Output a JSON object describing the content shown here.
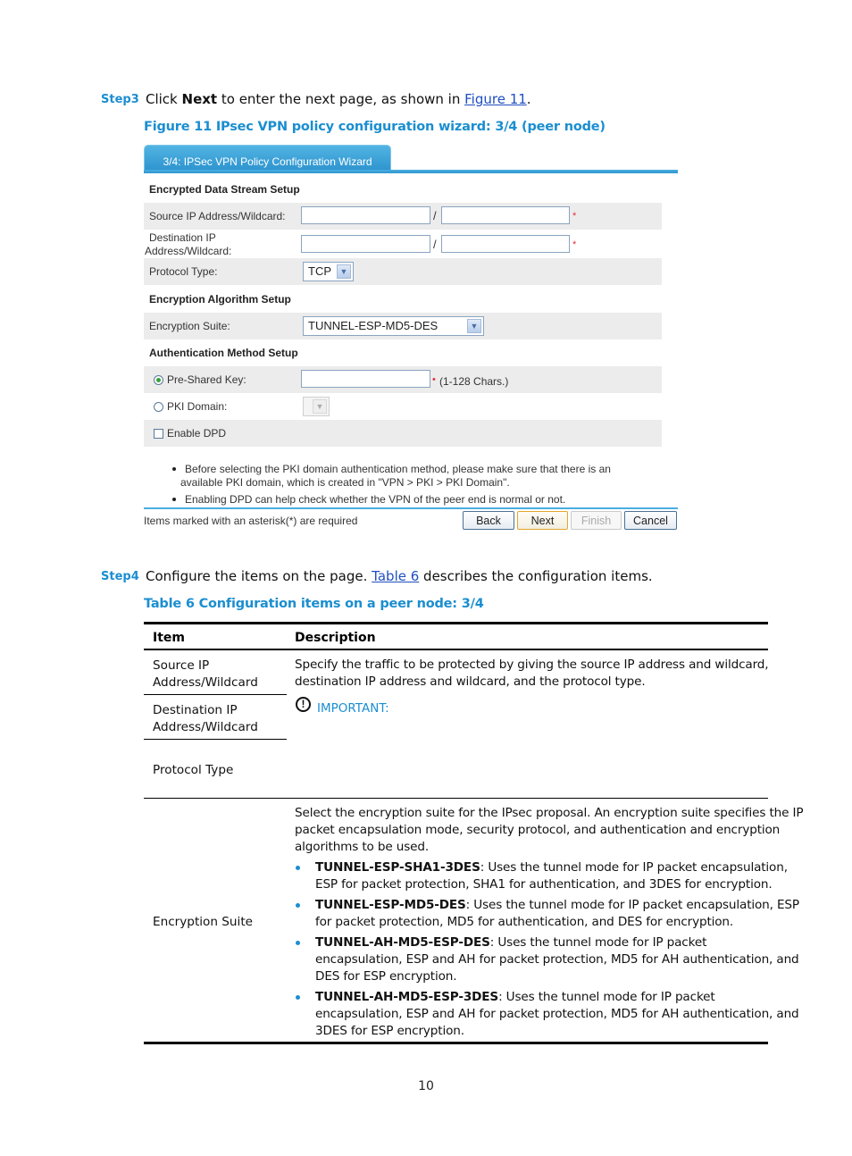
{
  "step3": {
    "label": "Step3",
    "text_before": "Click ",
    "bold": "Next",
    "text_middle": " to enter the next page, as shown in ",
    "link": "Figure 11",
    "text_after": "."
  },
  "figure_caption": "Figure 11 IPsec VPN policy configuration wizard: 3/4 (peer node)",
  "wizard": {
    "tab_title": "3/4: IPSec VPN Policy Configuration Wizard",
    "sections": {
      "data_stream": "Encrypted Data Stream Setup",
      "encryption": "Encryption Algorithm Setup",
      "auth": "Authentication Method Setup"
    },
    "fields": {
      "source_label": "Source IP Address/Wildcard:",
      "source_ip": "",
      "source_wildcard": "",
      "dest_label_line1": "Destination IP",
      "dest_label_line2": "Address/Wildcard:",
      "dest_ip": "",
      "dest_wildcard": "",
      "slash": "/",
      "required_mark": "*",
      "protocol_label": "Protocol Type:",
      "protocol_value": "TCP",
      "suite_label": "Encryption Suite:",
      "suite_value": "TUNNEL-ESP-MD5-DES",
      "psk_label": "Pre-Shared Key:",
      "psk_value": "",
      "psk_hint": "(1-128 Chars.)",
      "psk_selected": true,
      "pki_label": "PKI Domain:",
      "pki_value": "",
      "pki_selected": false,
      "dpd_label": "Enable DPD",
      "dpd_checked": false
    },
    "notes": [
      {
        "line1": "Before selecting the PKI domain authentication method, please make sure that there is an",
        "line2": "available PKI domain, which is created in \"VPN > PKI > PKI Domain\"."
      },
      {
        "line1": "Enabling DPD can help check whether the VPN of the peer end is normal or not.",
        "line2": ""
      }
    ],
    "required_note": "Items marked with an asterisk(*) are required",
    "buttons": {
      "back": "Back",
      "next": "Next",
      "finish": "Finish",
      "cancel": "Cancel"
    },
    "colors": {
      "tab": "#2f95cf",
      "required": "#e0303c",
      "row_gray": "#ececec"
    }
  },
  "step4": {
    "label": "Step4",
    "text_before": "Configure the items on the page. ",
    "link": "Table 6",
    "text_after": " describes the configuration items."
  },
  "table_caption": "Table 6 Configuration items on a peer node: 3/4",
  "table": {
    "headers": {
      "item": "Item",
      "description": "Description"
    },
    "rows": {
      "source": {
        "line1": "Source IP",
        "line2": "Address/Wildcard"
      },
      "dest": {
        "line1": "Destination IP",
        "line2": "Address/Wildcard"
      },
      "protocol": "Protocol Type",
      "suite": "Encryption Suite"
    },
    "desc_traffic": {
      "line1": "Specify the traffic to be protected by giving the source IP address and wildcard,",
      "line2": "destination IP address and wildcard, and the protocol type."
    },
    "important_label": "IMPORTANT:",
    "desc_suite": {
      "line1": "Select the encryption suite for the IPsec proposal. An encryption suite specifies the IP",
      "line2": "packet encapsulation mode, security protocol, and authentication and encryption",
      "line3": "algorithms to be used."
    },
    "suites": [
      {
        "name": "TUNNEL-ESP-SHA1-3DES",
        "l1": ": Uses the tunnel mode for IP packet encapsulation,",
        "l2": "ESP for packet protection, SHA1 for authentication, and 3DES for encryption.",
        "l3": ""
      },
      {
        "name": "TUNNEL-ESP-MD5-DES",
        "l1": ": Uses the tunnel mode for IP packet encapsulation, ESP",
        "l2": "for packet protection, MD5 for authentication, and DES for encryption.",
        "l3": ""
      },
      {
        "name": "TUNNEL-AH-MD5-ESP-DES",
        "l1": ": Uses the tunnel mode for IP packet",
        "l2": "encapsulation, ESP and AH for packet protection, MD5 for AH authentication, and",
        "l3": "DES for ESP encryption."
      },
      {
        "name": "TUNNEL-AH-MD5-ESP-3DES",
        "l1": ": Uses the tunnel mode for IP packet",
        "l2": "encapsulation, ESP and AH for packet protection, MD5 for AH authentication, and",
        "l3": "3DES for ESP encryption."
      }
    ]
  },
  "page_number": "10"
}
